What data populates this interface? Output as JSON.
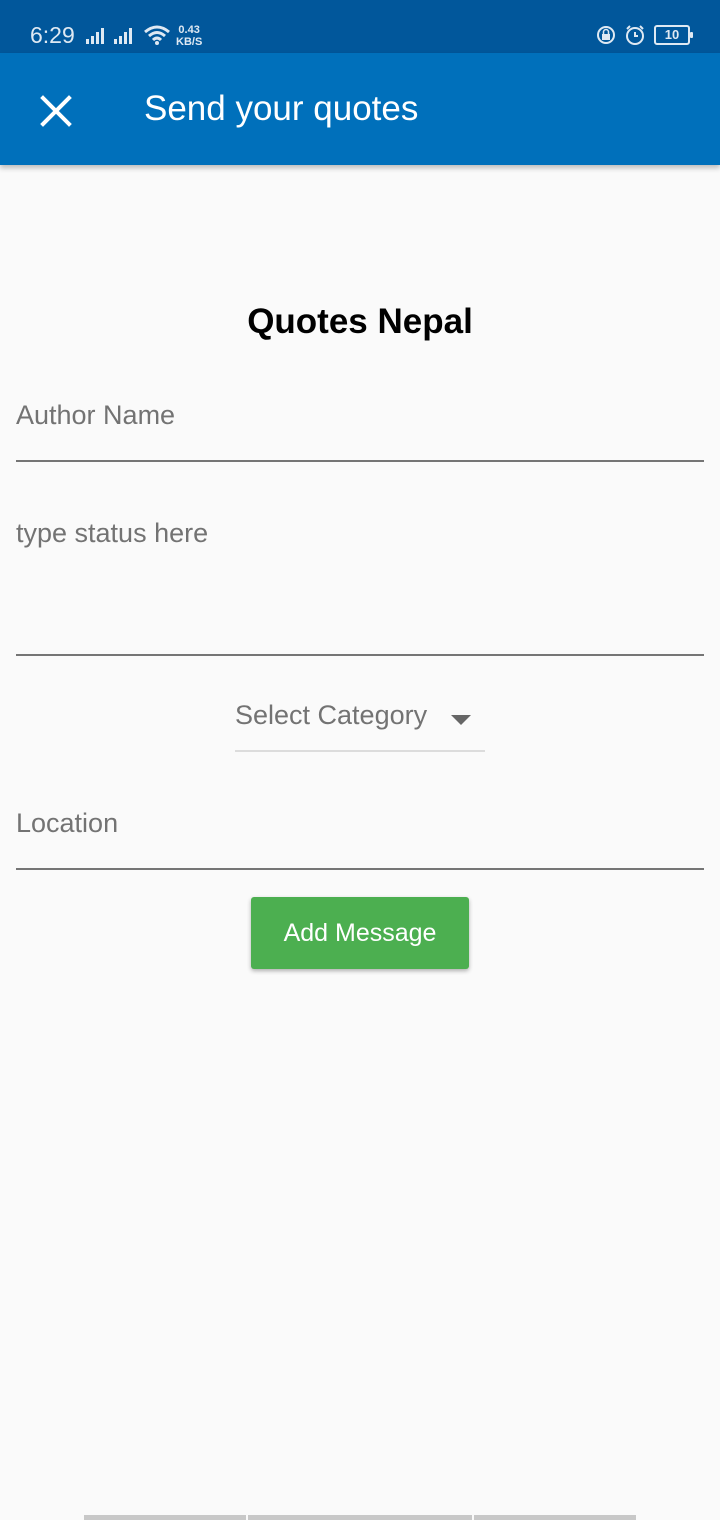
{
  "status_bar": {
    "time": "6:29",
    "speed_value": "0.43",
    "speed_unit": "KB/S",
    "battery": "10"
  },
  "app_bar": {
    "title": "Send your quotes",
    "close_icon": "close-icon"
  },
  "form": {
    "heading": "Quotes Nepal",
    "author_placeholder": "Author Name",
    "status_placeholder": "type status here",
    "category_selected": "Select Category",
    "location_placeholder": "Location",
    "submit_label": "Add Message"
  },
  "colors": {
    "app_bar": "#0070bb",
    "status_bar": "#01579b",
    "button": "#4caf50",
    "background": "#fafafa"
  }
}
